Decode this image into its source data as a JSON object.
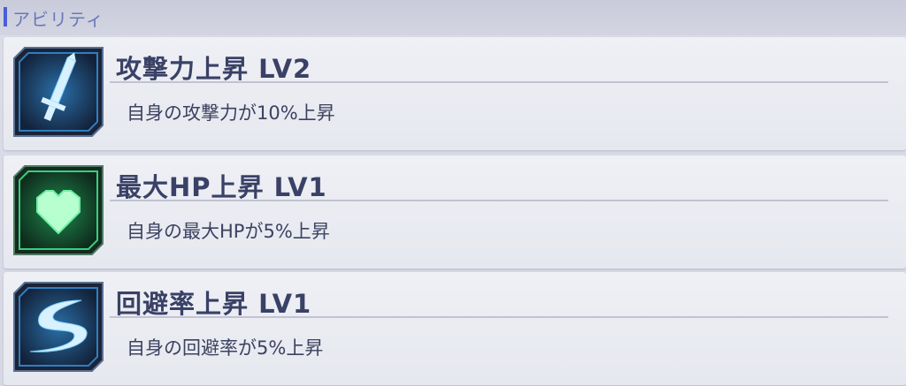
{
  "header": {
    "title": "アビリティ"
  },
  "abilities": [
    {
      "title": "攻撃力上昇 LV2",
      "description": "自身の攻撃力が10%上昇",
      "icon": "sword-icon",
      "color": "#3fa6e8"
    },
    {
      "title": "最大HP上昇 LV1",
      "description": "自身の最大HPが5%上昇",
      "icon": "heart-icon",
      "color": "#36d07a"
    },
    {
      "title": "回避率上昇 LV1",
      "description": "自身の回避率が5%上昇",
      "icon": "swoosh-icon",
      "color": "#3fa6e8"
    }
  ]
}
